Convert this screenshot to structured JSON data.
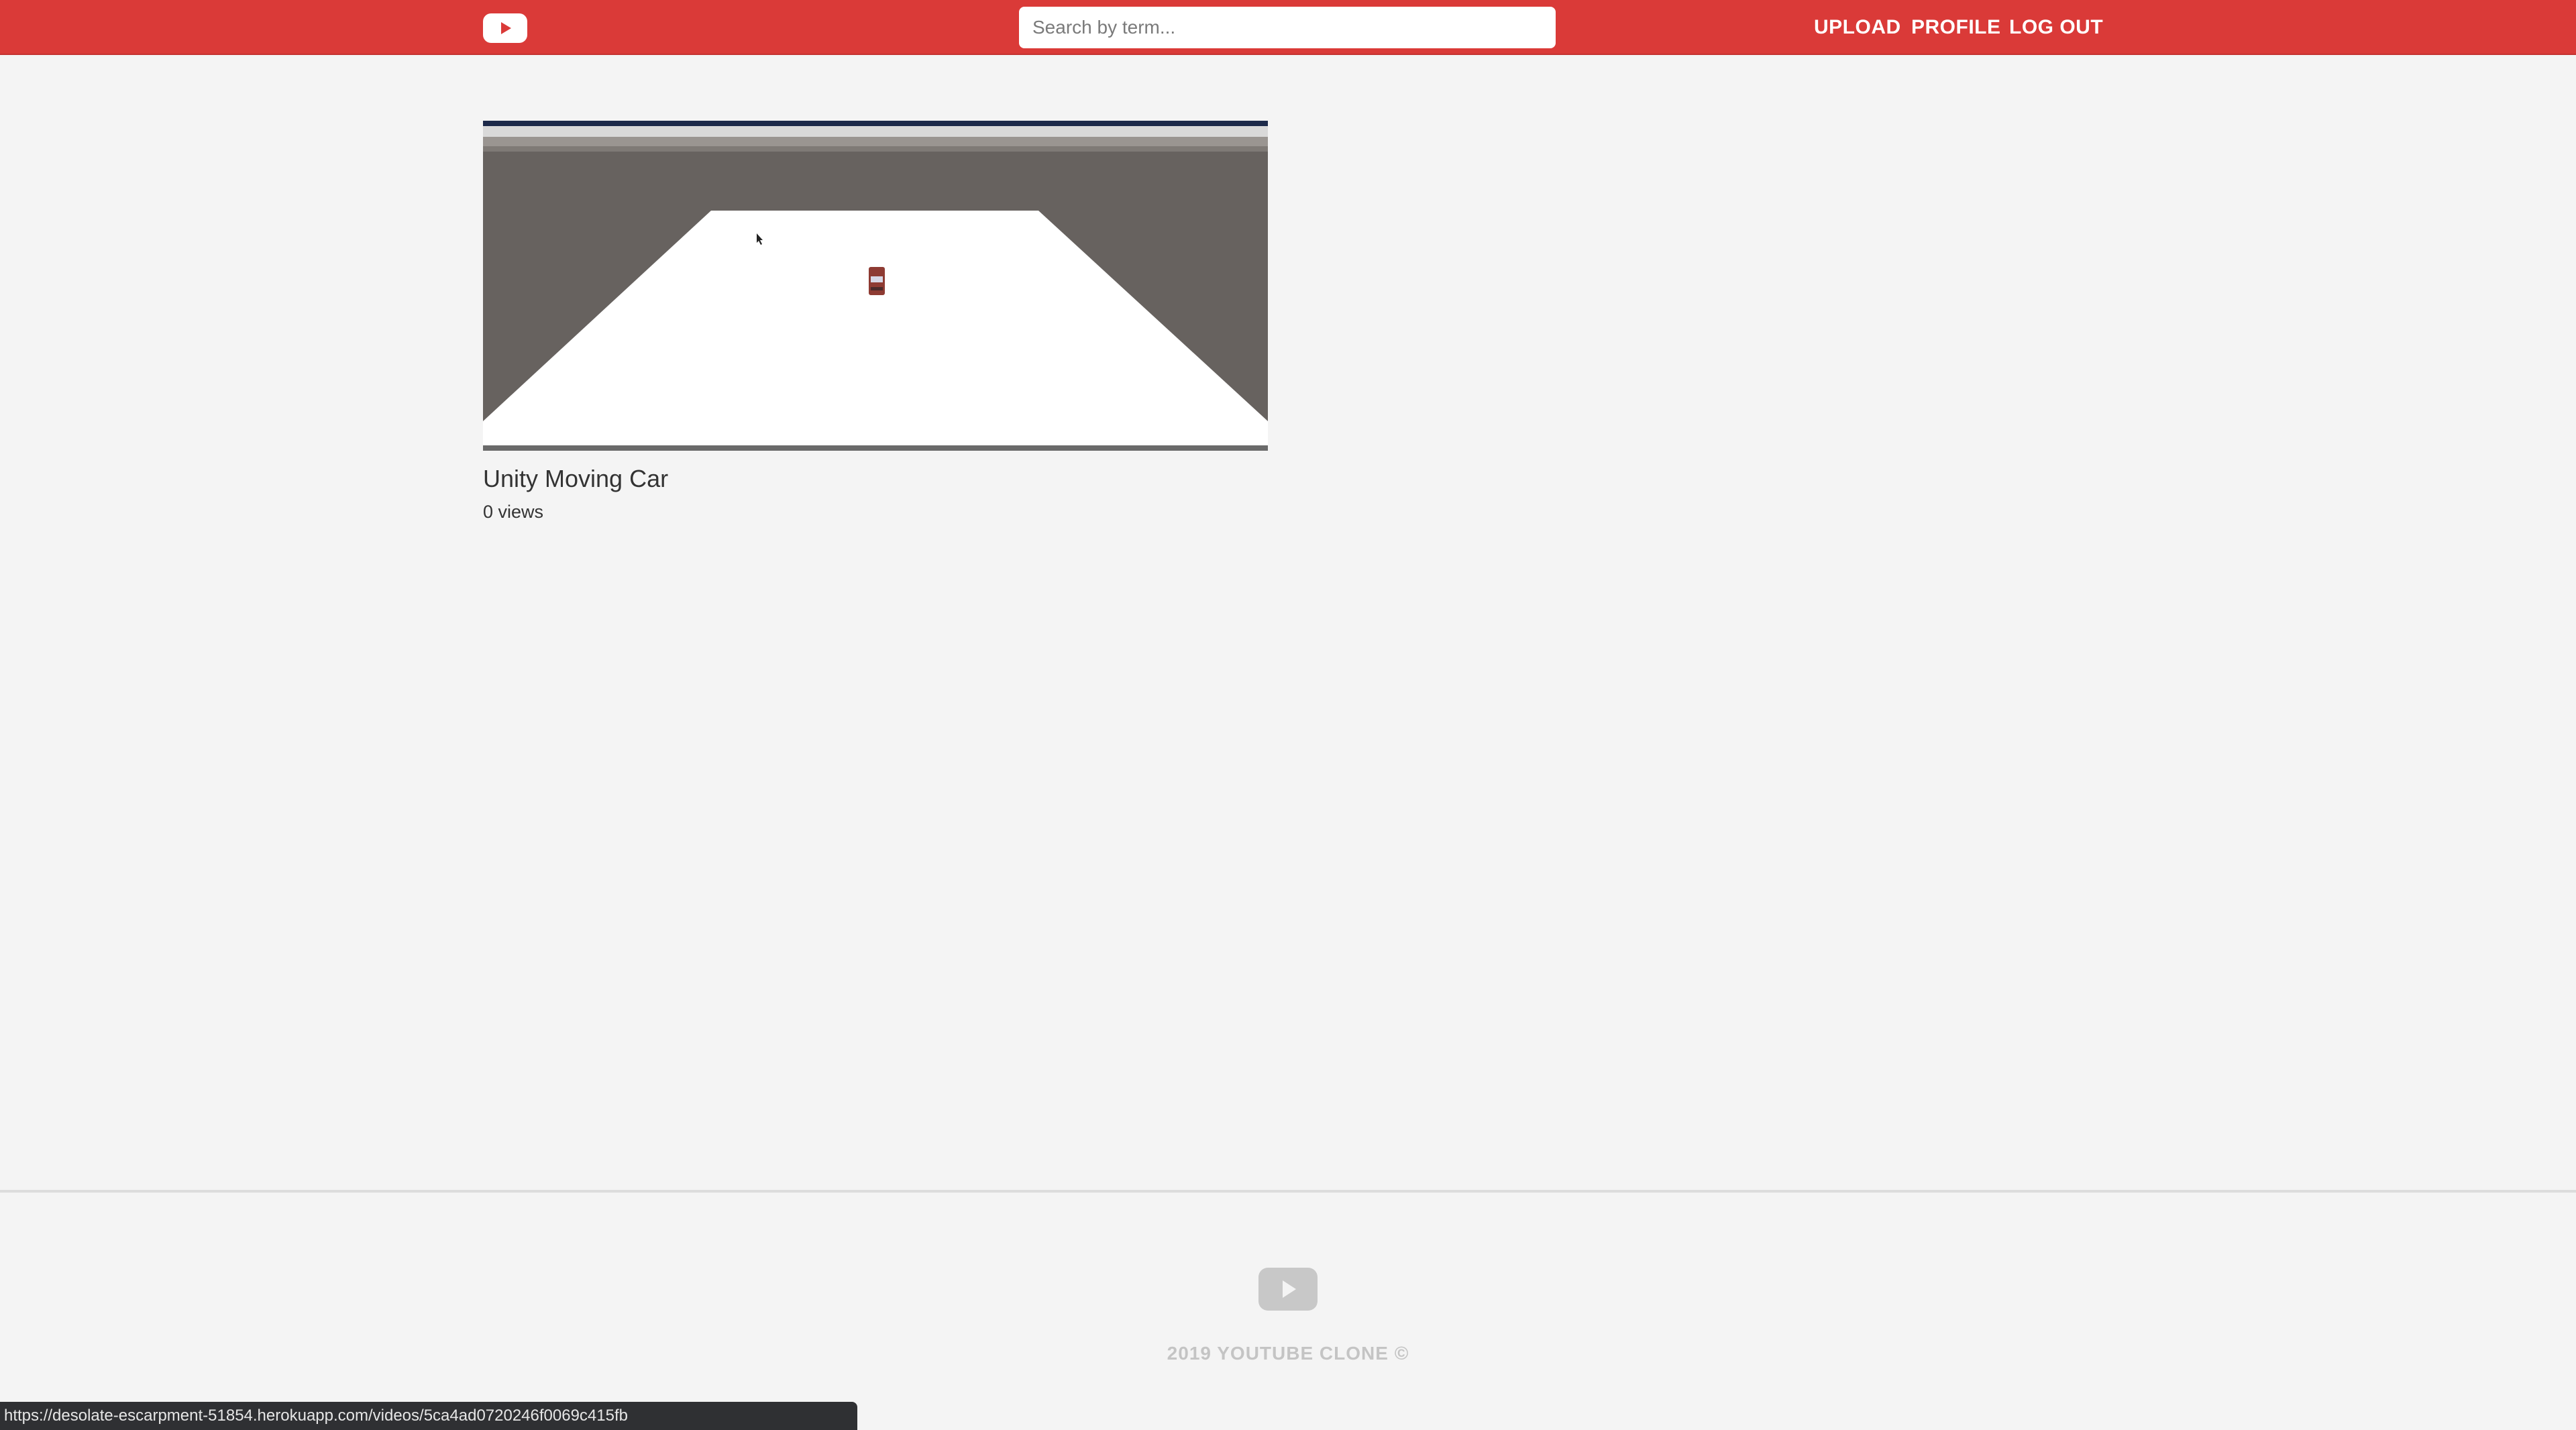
{
  "header": {
    "logo_icon": "play-logo-icon",
    "search": {
      "placeholder": "Search by term...",
      "value": ""
    },
    "nav": {
      "upload": "UPLOAD",
      "profile": "PROFILE",
      "logout": "LOG OUT"
    },
    "accent_color": "#da3a38"
  },
  "videos": [
    {
      "title": "Unity Moving Car",
      "views": "0 views",
      "thumbnail_icon": "video-thumbnail"
    }
  ],
  "footer": {
    "logo_icon": "play-logo-icon",
    "copyright": "2019 YOUTUBE CLONE ©"
  },
  "status_bar": {
    "url": "https://desolate-escarpment-51854.herokuapp.com/videos/5ca4ad0720246f0069c415fb"
  }
}
